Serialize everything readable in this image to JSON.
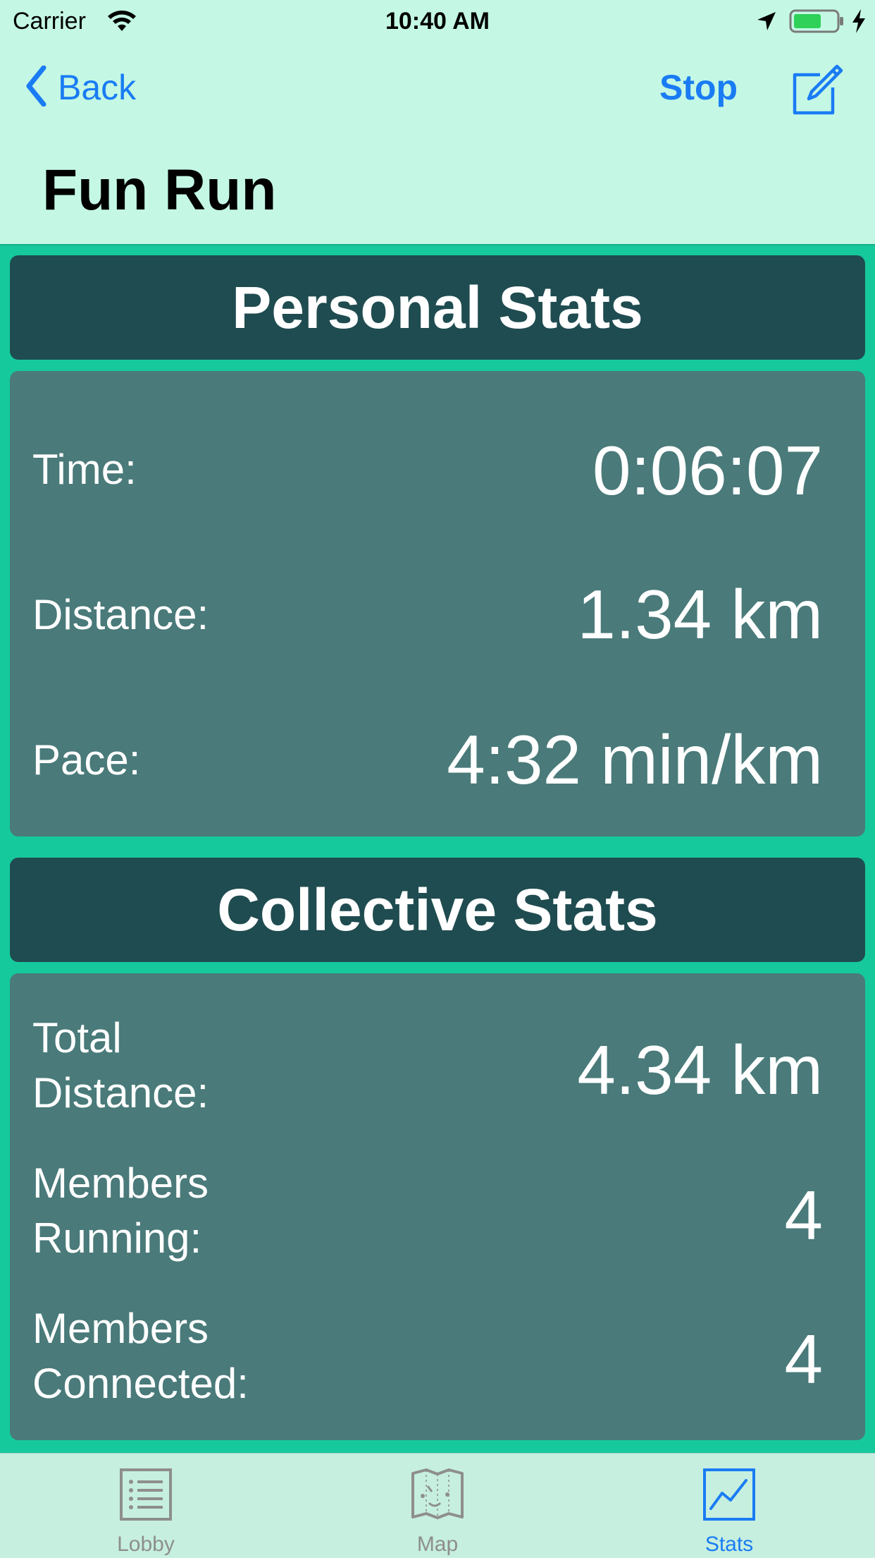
{
  "status_bar": {
    "carrier": "Carrier",
    "time": "10:40 AM"
  },
  "nav": {
    "back_label": "Back",
    "stop_label": "Stop",
    "title": "Fun Run"
  },
  "personal": {
    "header": "Personal Stats",
    "time_label": "Time:",
    "time_value": "0:06:07",
    "distance_label": "Distance:",
    "distance_value": "1.34 km",
    "pace_label": "Pace:",
    "pace_value": "4:32 min/km"
  },
  "collective": {
    "header": "Collective Stats",
    "total_distance_label_1": "Total",
    "total_distance_label_2": "Distance:",
    "total_distance_value": "4.34 km",
    "members_running_label_1": "Members",
    "members_running_label_2": "Running:",
    "members_running_value": "4",
    "members_connected_label_1": "Members",
    "members_connected_label_2": "Connected:",
    "members_connected_value": "4"
  },
  "tabs": [
    {
      "label": "Lobby",
      "icon": "list-icon",
      "active": false
    },
    {
      "label": "Map",
      "icon": "map-icon",
      "active": false
    },
    {
      "label": "Stats",
      "icon": "chart-icon",
      "active": true
    }
  ],
  "colors": {
    "accent": "#1a7cf4",
    "background": "#c4f8e4",
    "content_background": "#15c99c",
    "section_header": "#1f4c50",
    "panel": "#4a7a7a"
  }
}
